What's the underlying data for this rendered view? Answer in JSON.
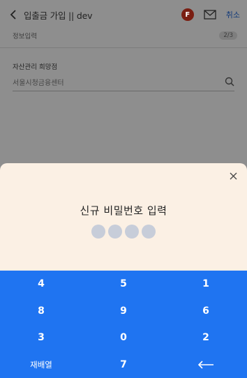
{
  "header": {
    "title": "입출금 가입 || dev",
    "badge": "F",
    "cancel_label": "취소"
  },
  "progress": {
    "section_label": "정보입력",
    "step": "2/3"
  },
  "branch": {
    "label": "자산관리 희망점",
    "value": "서울시청금융센터"
  },
  "pin_sheet": {
    "title": "신규 비밀번호 입력",
    "dots_total": 4,
    "dots_filled": 0
  },
  "keypad": {
    "keys": [
      "4",
      "5",
      "1",
      "8",
      "9",
      "6",
      "3",
      "0",
      "2",
      "재배열",
      "7",
      "←"
    ]
  },
  "colors": {
    "keypad_bg": "#1f74f1",
    "sheet_bg": "#fbf0e4",
    "badge_bg": "#7a1e12",
    "dot_color": "#c7cdd9"
  },
  "icons": [
    "back-chevron-icon",
    "mail-icon",
    "search-icon",
    "close-icon",
    "backspace-arrow-icon"
  ]
}
